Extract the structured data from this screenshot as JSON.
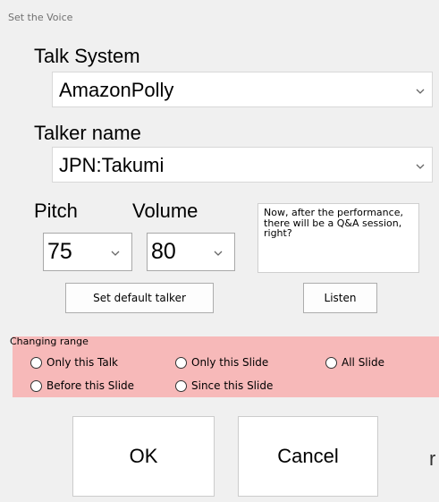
{
  "window": {
    "title": "Set the Voice"
  },
  "talk_system": {
    "label": "Talk System",
    "selected": "AmazonPolly",
    "icon": "chevron-down-icon"
  },
  "talker_name": {
    "label": "Talker name",
    "selected": "JPN:Takumi",
    "icon": "chevron-down-icon"
  },
  "pitch": {
    "label": "Pitch",
    "selected": "75",
    "icon": "chevron-down-icon"
  },
  "volume": {
    "label": "Volume",
    "selected": "80",
    "icon": "chevron-down-icon"
  },
  "sample_text": {
    "value": "Now, after the performance, there will be a Q&A session, right?"
  },
  "buttons": {
    "set_default": "Set default talker",
    "listen": "Listen",
    "ok": "OK",
    "cancel": "Cancel"
  },
  "changing_range": {
    "label": "Changing range",
    "background_color": "#f7b9b9",
    "options": [
      {
        "label": "Only this Talk",
        "selected": false
      },
      {
        "label": "Only this Slide",
        "selected": false
      },
      {
        "label": "All Slide",
        "selected": false
      },
      {
        "label": "Before this Slide",
        "selected": false
      },
      {
        "label": "Since this Slide",
        "selected": false
      }
    ]
  },
  "stray_text": "r",
  "colors": {
    "dialog_background": "#f0f0f0",
    "panel_highlight": "#f7b9b9"
  }
}
